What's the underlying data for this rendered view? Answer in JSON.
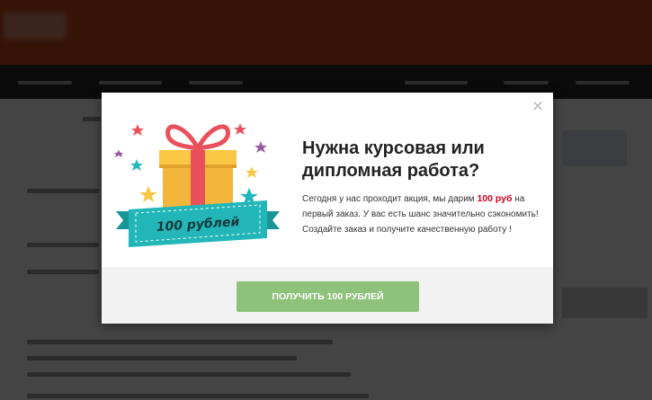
{
  "modal": {
    "close_symbol": "×",
    "gift_ribbon_text": "100 рублей",
    "title": "Нужна курсовая или дипломная работа?",
    "description": {
      "before": "Сегодня у нас проходит акция, мы дарим ",
      "highlight": "100 руб",
      "after": " на первый заказ. У вас есть шанс значительно сэкономить! Создайте заказ и получите качественную работу !"
    },
    "cta_label": "ПОЛУЧИТЬ 100 РУБЛЕЙ"
  },
  "colors": {
    "header_bg": "#c0461a",
    "gift_box": "#f9c744",
    "gift_bow": "#e8515b",
    "ribbon": "#23b6b8",
    "highlight": "#d0021b",
    "cta_bg": "#8ec27b"
  },
  "icons": [
    "gift-icon",
    "star-icon",
    "close-icon"
  ]
}
